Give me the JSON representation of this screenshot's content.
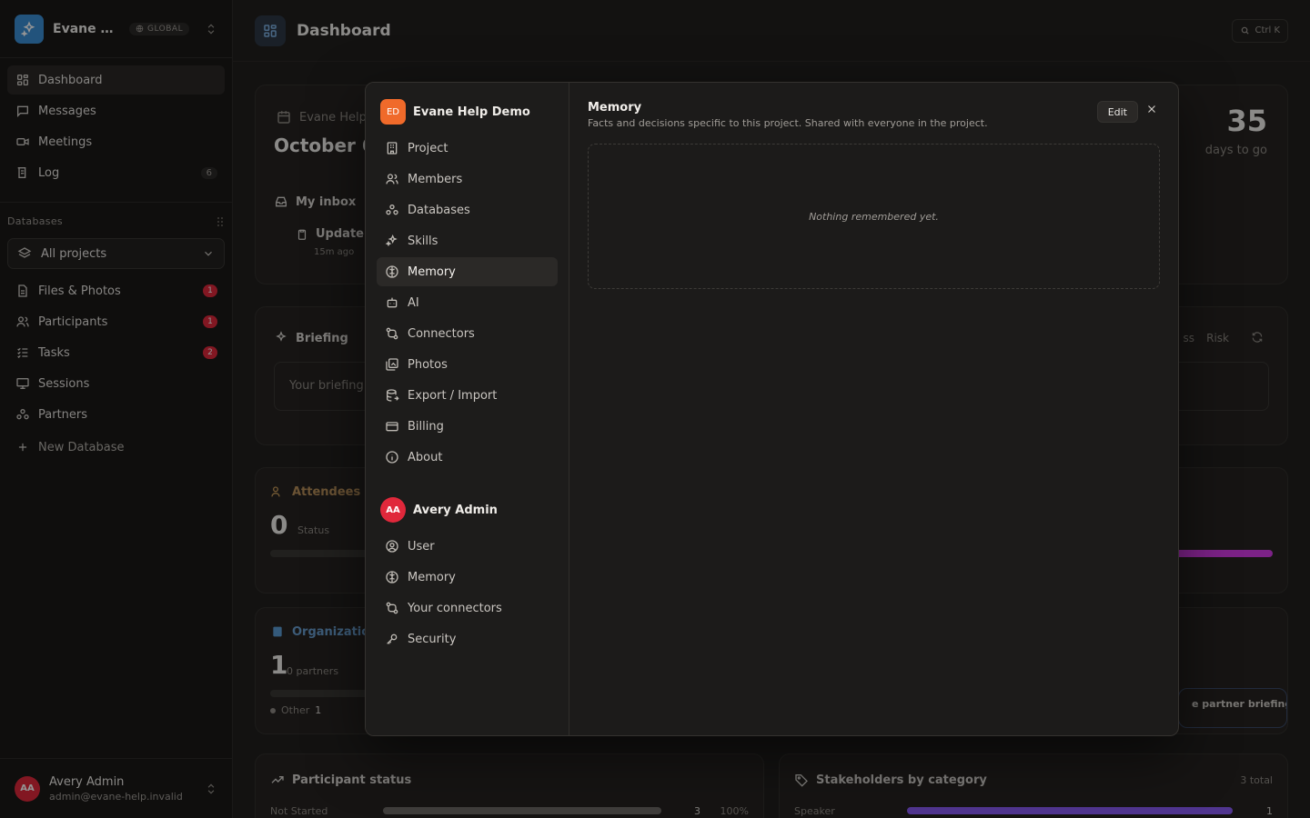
{
  "workspace": {
    "name": "Evane Help Demo",
    "badge": "GLOBAL"
  },
  "sidebar": {
    "nav": [
      {
        "label": "Dashboard",
        "icon": "dashboard-icon",
        "active": true
      },
      {
        "label": "Messages",
        "icon": "message-icon"
      },
      {
        "label": "Meetings",
        "icon": "video-icon"
      },
      {
        "label": "Log",
        "icon": "log-icon",
        "count": "6"
      }
    ],
    "databases_heading": "Databases",
    "project_select": "All projects",
    "databases": [
      {
        "label": "Files & Photos",
        "badge": "1"
      },
      {
        "label": "Participants",
        "badge": "1"
      },
      {
        "label": "Tasks",
        "badge": "2"
      },
      {
        "label": "Sessions"
      },
      {
        "label": "Partners"
      }
    ],
    "new_database": "New Database"
  },
  "user": {
    "initials": "AA",
    "name": "Avery Admin",
    "email": "admin@evane-help.invalid"
  },
  "topbar": {
    "title": "Dashboard",
    "shortcut": "Ctrl K"
  },
  "background": {
    "header_card": {
      "project": "Evane Help",
      "date": "October 6",
      "days": "35",
      "days_label": "days to go",
      "inbox": "My inbox",
      "inbox_item": "Update",
      "inbox_time": "15m ago"
    },
    "briefing": {
      "title": "Briefing",
      "placeholder": "Your briefing",
      "tab1": "ss",
      "tab2": "Risk"
    },
    "attendees": {
      "title": "Attendees (",
      "value": "0",
      "label": "Status"
    },
    "organizations": {
      "title": "Organizatio",
      "value": "1",
      "label": "0 partners",
      "legend": "Other",
      "legend_value": "1"
    },
    "partner_briefing": "e partner briefing",
    "participant_status": {
      "title": "Participant status",
      "row_label": "Not Started",
      "row_value": "3",
      "row_pct": "100%"
    },
    "stakeholders": {
      "title": "Stakeholders by category",
      "total": "3 total",
      "row_label": "Speaker",
      "row_value": "1"
    },
    "colors": {
      "accent_pink": "#d63ce8",
      "accent_purple": "#8b5cf6"
    }
  },
  "modal": {
    "project_initials": "ED",
    "project_name": "Evane Help Demo",
    "project_items": [
      {
        "label": "Project",
        "icon": "building-icon"
      },
      {
        "label": "Members",
        "icon": "members-icon"
      },
      {
        "label": "Databases",
        "icon": "databases-icon"
      },
      {
        "label": "Skills",
        "icon": "sparkles-icon"
      },
      {
        "label": "Memory",
        "icon": "brain-icon",
        "active": true
      },
      {
        "label": "AI",
        "icon": "bot-icon"
      },
      {
        "label": "Connectors",
        "icon": "connectors-icon"
      },
      {
        "label": "Photos",
        "icon": "photos-icon"
      },
      {
        "label": "Export / Import",
        "icon": "database-export-icon"
      },
      {
        "label": "Billing",
        "icon": "credit-card-icon"
      },
      {
        "label": "About",
        "icon": "info-icon"
      }
    ],
    "user_initials": "AA",
    "user_name": "Avery Admin",
    "user_items": [
      {
        "label": "User",
        "icon": "user-circle-icon"
      },
      {
        "label": "Memory",
        "icon": "brain-icon"
      },
      {
        "label": "Your connectors",
        "icon": "connectors-icon"
      },
      {
        "label": "Security",
        "icon": "key-icon"
      }
    ],
    "content": {
      "title": "Memory",
      "description": "Facts and decisions specific to this project. Shared with everyone in the project.",
      "edit_label": "Edit",
      "empty_text": "Nothing remembered yet."
    }
  }
}
